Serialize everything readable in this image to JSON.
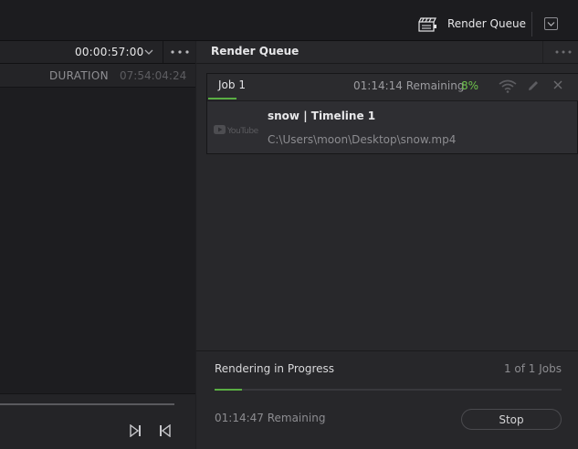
{
  "topbar": {
    "render_queue_label": "Render Queue",
    "icon": "render-queue-clapper-icon",
    "menu_icon": "chevron-down-icon"
  },
  "left_panel": {
    "timecode": "00:00:57:00",
    "duration_label": "DURATION",
    "duration_value": "07:54:04:24",
    "controls": [
      "next-frame-icon",
      "previous-frame-icon"
    ]
  },
  "render_queue": {
    "title": "Render Queue",
    "jobs": [
      {
        "tab_label": "Job 1",
        "remaining": "01:14:14 Remaining",
        "percent": "8%",
        "name": "snow | Timeline 1",
        "path": "C:\\Users\\moon\\Desktop\\snow.mp4",
        "logo": "youtube-logo",
        "icons": [
          "wifi-icon",
          "pencil-icon",
          "close-icon"
        ]
      }
    ],
    "footer": {
      "status": "Rendering in Progress",
      "job_count": "1 of 1 Jobs",
      "progress": 0.08,
      "remaining": "01:14:47 Remaining",
      "stop_label": "Stop"
    }
  },
  "colors": {
    "accent_green": "#5aae43",
    "percent_green": "#6ec24c"
  }
}
